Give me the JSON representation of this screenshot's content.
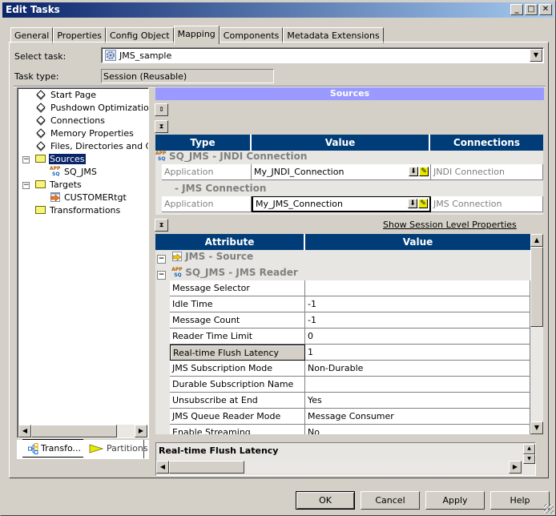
{
  "window": {
    "title": "Edit Tasks",
    "controls": {
      "minimize": "_",
      "maximize": "□",
      "close": "✕"
    }
  },
  "tabs": [
    {
      "label": "General",
      "active": false
    },
    {
      "label": "Properties",
      "active": false
    },
    {
      "label": "Config Object",
      "active": false
    },
    {
      "label": "Mapping",
      "active": true
    },
    {
      "label": "Components",
      "active": false
    },
    {
      "label": "Metadata Extensions",
      "active": false
    }
  ],
  "task": {
    "select_label": "Select task:",
    "select_value": "JMS_sample",
    "select_icon": "session-gear-icon",
    "type_label": "Task type:",
    "type_value": "Session (Reusable)"
  },
  "tree": {
    "items": [
      {
        "label": "Start Page",
        "icon": "diamond-icon",
        "level": 1
      },
      {
        "label": "Pushdown Optimization",
        "icon": "diamond-icon",
        "level": 1
      },
      {
        "label": "Connections",
        "icon": "diamond-icon",
        "level": 1
      },
      {
        "label": "Memory Properties",
        "icon": "diamond-icon",
        "level": 1
      },
      {
        "label": "Files, Directories and Commands",
        "icon": "diamond-icon",
        "level": 1
      },
      {
        "label": "Sources",
        "icon": "folder-icon",
        "level": 0,
        "expanded": true,
        "selected": true
      },
      {
        "label": "SQ_JMS",
        "icon": "source-qualifier-icon",
        "level": 2
      },
      {
        "label": "Targets",
        "icon": "folder-icon",
        "level": 0,
        "expanded": true
      },
      {
        "label": "CUSTOMERtgt",
        "icon": "target-icon",
        "level": 2
      },
      {
        "label": "Transformations",
        "icon": "folder-icon",
        "level": 1
      }
    ],
    "expand_glyph": "−"
  },
  "bottom_tabs": [
    {
      "label": "Transfo...",
      "icon": "transformations-icon",
      "active": false
    },
    {
      "label": "Partitions",
      "icon": "partitions-icon",
      "active": true
    }
  ],
  "sources_panel": {
    "header": "Sources",
    "connections_table": {
      "columns": [
        "Type",
        "Value",
        "Connections"
      ],
      "groups": [
        {
          "title": "SQ_JMS - JNDI Connection",
          "rows": [
            {
              "type": "Application",
              "value": "My_JNDI_Connection",
              "connection": "JNDI Connection"
            }
          ]
        },
        {
          "title": "- JMS Connection",
          "rows": [
            {
              "type": "Application",
              "value": "My_JMS_Connection",
              "connection": "JMS Connection"
            }
          ]
        }
      ]
    },
    "show_session_link": "Show Session Level Properties",
    "attributes_table": {
      "columns": [
        "Attribute",
        "Value"
      ],
      "groups": [
        {
          "title": "JMS - Source"
        },
        {
          "title": "SQ_JMS - JMS Reader"
        }
      ],
      "rows": [
        {
          "attribute": "Message Selector",
          "value": ""
        },
        {
          "attribute": "Idle Time",
          "value": "-1"
        },
        {
          "attribute": "Message Count",
          "value": "-1"
        },
        {
          "attribute": "Reader Time Limit",
          "value": "0"
        },
        {
          "attribute": "Real-time Flush Latency",
          "value": "1",
          "selected": true
        },
        {
          "attribute": "JMS Subscription Mode",
          "value": "Non-Durable"
        },
        {
          "attribute": "Durable Subscription Name",
          "value": ""
        },
        {
          "attribute": "Unsubscribe at End",
          "value": "Yes"
        },
        {
          "attribute": "JMS Queue Reader Mode",
          "value": "Message Consumer"
        },
        {
          "attribute": "Enable Streaming",
          "value": "No"
        }
      ]
    },
    "description_title": "Real-time Flush Latency"
  },
  "buttons": {
    "ok": "OK",
    "cancel": "Cancel",
    "apply": "Apply",
    "help": "Help"
  }
}
